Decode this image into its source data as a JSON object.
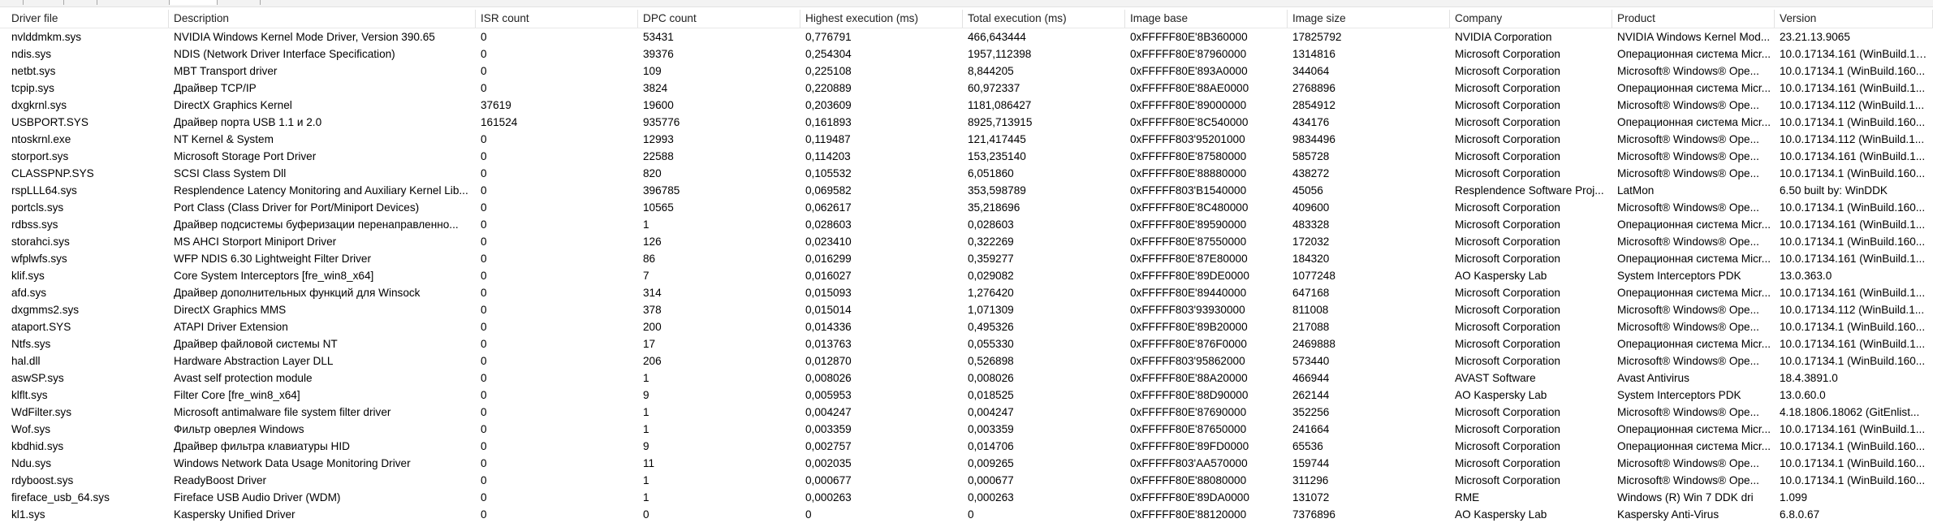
{
  "columns": [
    "Driver file",
    "Description",
    "ISR count",
    "DPC count",
    "Highest execution (ms)",
    "Total execution (ms)",
    "Image base",
    "Image size",
    "Company",
    "Product",
    "Version"
  ],
  "rows": [
    [
      "nvlddmkm.sys",
      "NVIDIA Windows Kernel Mode Driver, Version 390.65",
      "0",
      "53431",
      "0,776791",
      "466,643444",
      "0xFFFFF80E'8B360000",
      "17825792",
      "NVIDIA Corporation",
      "NVIDIA Windows Kernel Mod...",
      "23.21.13.9065"
    ],
    [
      "ndis.sys",
      "NDIS (Network Driver Interface Specification)",
      "0",
      "39376",
      "0,254304",
      "1957,112398",
      "0xFFFFF80E'87960000",
      "1314816",
      "Microsoft Corporation",
      "Операционная система Micr...",
      "10.0.17134.161 (WinBuild.160..."
    ],
    [
      "netbt.sys",
      "MBT Transport driver",
      "0",
      "109",
      "0,225108",
      "8,844205",
      "0xFFFFF80E'893A0000",
      "344064",
      "Microsoft Corporation",
      "Microsoft® Windows® Ope...",
      "10.0.17134.1 (WinBuild.160..."
    ],
    [
      "tcpip.sys",
      "Драйвер TCP/IP",
      "0",
      "3824",
      "0,220889",
      "60,972337",
      "0xFFFFF80E'88AE0000",
      "2768896",
      "Microsoft Corporation",
      "Операционная система Micr...",
      "10.0.17134.161 (WinBuild.1..."
    ],
    [
      "dxgkrnl.sys",
      "DirectX Graphics Kernel",
      "37619",
      "19600",
      "0,203609",
      "1181,086427",
      "0xFFFFF80E'89000000",
      "2854912",
      "Microsoft Corporation",
      "Microsoft® Windows® Ope...",
      "10.0.17134.112 (WinBuild.1..."
    ],
    [
      "USBPORT.SYS",
      "Драйвер порта USB 1.1 и 2.0",
      "161524",
      "935776",
      "0,161893",
      "8925,713915",
      "0xFFFFF80E'8C540000",
      "434176",
      "Microsoft Corporation",
      "Операционная система Micr...",
      "10.0.17134.1 (WinBuild.160..."
    ],
    [
      "ntoskrnl.exe",
      "NT Kernel & System",
      "0",
      "12993",
      "0,119487",
      "121,417445",
      "0xFFFFF803'95201000",
      "9834496",
      "Microsoft Corporation",
      "Microsoft® Windows® Ope...",
      "10.0.17134.112 (WinBuild.1..."
    ],
    [
      "storport.sys",
      "Microsoft Storage Port Driver",
      "0",
      "22588",
      "0,114203",
      "153,235140",
      "0xFFFFF80E'87580000",
      "585728",
      "Microsoft Corporation",
      "Microsoft® Windows® Ope...",
      "10.0.17134.161 (WinBuild.1..."
    ],
    [
      "CLASSPNP.SYS",
      "SCSI Class System Dll",
      "0",
      "820",
      "0,105532",
      "6,051860",
      "0xFFFFF80E'88880000",
      "438272",
      "Microsoft Corporation",
      "Microsoft® Windows® Ope...",
      "10.0.17134.1 (WinBuild.160..."
    ],
    [
      "rspLLL64.sys",
      "Resplendence Latency Monitoring and Auxiliary Kernel Lib...",
      "0",
      "396785",
      "0,069582",
      "353,598789",
      "0xFFFFF803'B1540000",
      "45056",
      "Resplendence Software Proj...",
      "LatMon",
      "6.50 built by: WinDDK"
    ],
    [
      "portcls.sys",
      "Port Class (Class Driver for Port/Miniport Devices)",
      "0",
      "10565",
      "0,062617",
      "35,218696",
      "0xFFFFF80E'8C480000",
      "409600",
      "Microsoft Corporation",
      "Microsoft® Windows® Ope...",
      "10.0.17134.1 (WinBuild.160..."
    ],
    [
      "rdbss.sys",
      "Драйвер подсистемы буферизации перенаправленно...",
      "0",
      "1",
      "0,028603",
      "0,028603",
      "0xFFFFF80E'89590000",
      "483328",
      "Microsoft Corporation",
      "Операционная система Micr...",
      "10.0.17134.161 (WinBuild.1..."
    ],
    [
      "storahci.sys",
      "MS AHCI Storport Miniport Driver",
      "0",
      "126",
      "0,023410",
      "0,322269",
      "0xFFFFF80E'87550000",
      "172032",
      "Microsoft Corporation",
      "Microsoft® Windows® Ope...",
      "10.0.17134.1 (WinBuild.160..."
    ],
    [
      "wfplwfs.sys",
      "WFP NDIS 6.30 Lightweight Filter Driver",
      "0",
      "86",
      "0,016299",
      "0,359277",
      "0xFFFFF80E'87E80000",
      "184320",
      "Microsoft Corporation",
      "Операционная система Micr...",
      "10.0.17134.161 (WinBuild.1..."
    ],
    [
      "klif.sys",
      "Core System Interceptors [fre_win8_x64]",
      "0",
      "7",
      "0,016027",
      "0,029082",
      "0xFFFFF80E'89DE0000",
      "1077248",
      "AO Kaspersky Lab",
      "System Interceptors PDK",
      "13.0.363.0"
    ],
    [
      "afd.sys",
      "Драйвер дополнительных функций для Winsock",
      "0",
      "314",
      "0,015093",
      "1,276420",
      "0xFFFFF80E'89440000",
      "647168",
      "Microsoft Corporation",
      "Операционная система Micr...",
      "10.0.17134.161 (WinBuild.1..."
    ],
    [
      "dxgmms2.sys",
      "DirectX Graphics MMS",
      "0",
      "378",
      "0,015014",
      "1,071309",
      "0xFFFFF803'93930000",
      "811008",
      "Microsoft Corporation",
      "Microsoft® Windows® Ope...",
      "10.0.17134.112 (WinBuild.1..."
    ],
    [
      "ataport.SYS",
      "ATAPI Driver Extension",
      "0",
      "200",
      "0,014336",
      "0,495326",
      "0xFFFFF80E'89B20000",
      "217088",
      "Microsoft Corporation",
      "Microsoft® Windows® Ope...",
      "10.0.17134.1 (WinBuild.160..."
    ],
    [
      "Ntfs.sys",
      "Драйвер файловой системы NT",
      "0",
      "17",
      "0,013763",
      "0,055330",
      "0xFFFFF80E'876F0000",
      "2469888",
      "Microsoft Corporation",
      "Операционная система Micr...",
      "10.0.17134.161 (WinBuild.1..."
    ],
    [
      "hal.dll",
      "Hardware Abstraction Layer DLL",
      "0",
      "206",
      "0,012870",
      "0,526898",
      "0xFFFFF803'95862000",
      "573440",
      "Microsoft Corporation",
      "Microsoft® Windows® Ope...",
      "10.0.17134.1 (WinBuild.160..."
    ],
    [
      "aswSP.sys",
      "Avast self protection module",
      "0",
      "1",
      "0,008026",
      "0,008026",
      "0xFFFFF80E'88A20000",
      "466944",
      "AVAST Software",
      "Avast Antivirus",
      "18.4.3891.0"
    ],
    [
      "klflt.sys",
      "Filter Core [fre_win8_x64]",
      "0",
      "9",
      "0,005953",
      "0,018525",
      "0xFFFFF80E'88D90000",
      "262144",
      "AO Kaspersky Lab",
      "System Interceptors PDK",
      "13.0.60.0"
    ],
    [
      "WdFilter.sys",
      "Microsoft antimalware file system filter driver",
      "0",
      "1",
      "0,004247",
      "0,004247",
      "0xFFFFF80E'87690000",
      "352256",
      "Microsoft Corporation",
      "Microsoft® Windows® Ope...",
      "4.18.1806.18062 (GitEnlist..."
    ],
    [
      "Wof.sys",
      "Фильтр оверлея Windows",
      "0",
      "1",
      "0,003359",
      "0,003359",
      "0xFFFFF80E'87650000",
      "241664",
      "Microsoft Corporation",
      "Операционная система Micr...",
      "10.0.17134.161 (WinBuild.1..."
    ],
    [
      "kbdhid.sys",
      "Драйвер фильтра клавиатуры HID",
      "0",
      "9",
      "0,002757",
      "0,014706",
      "0xFFFFF80E'89FD0000",
      "65536",
      "Microsoft Corporation",
      "Операционная система Micr...",
      "10.0.17134.1 (WinBuild.160..."
    ],
    [
      "Ndu.sys",
      "Windows Network Data Usage Monitoring Driver",
      "0",
      "11",
      "0,002035",
      "0,009265",
      "0xFFFFF803'AA570000",
      "159744",
      "Microsoft Corporation",
      "Microsoft® Windows® Ope...",
      "10.0.17134.1 (WinBuild.160..."
    ],
    [
      "rdyboost.sys",
      "ReadyBoost Driver",
      "0",
      "1",
      "0,000677",
      "0,000677",
      "0xFFFFF80E'88080000",
      "311296",
      "Microsoft Corporation",
      "Microsoft® Windows® Ope...",
      "10.0.17134.1 (WinBuild.160..."
    ],
    [
      "fireface_usb_64.sys",
      "Fireface USB Audio Driver (WDM)",
      "0",
      "1",
      "0,000263",
      "0,000263",
      "0xFFFFF80E'89DA0000",
      "131072",
      "RME",
      "Windows (R) Win 7 DDK dri",
      "1.099"
    ],
    [
      "kl1.sys",
      "Kaspersky Unified Driver",
      "0",
      "0",
      "0",
      "0",
      "0xFFFFF80E'88120000",
      "7376896",
      "AO Kaspersky Lab",
      "Kaspersky Anti-Virus",
      "6.8.0.67"
    ]
  ]
}
